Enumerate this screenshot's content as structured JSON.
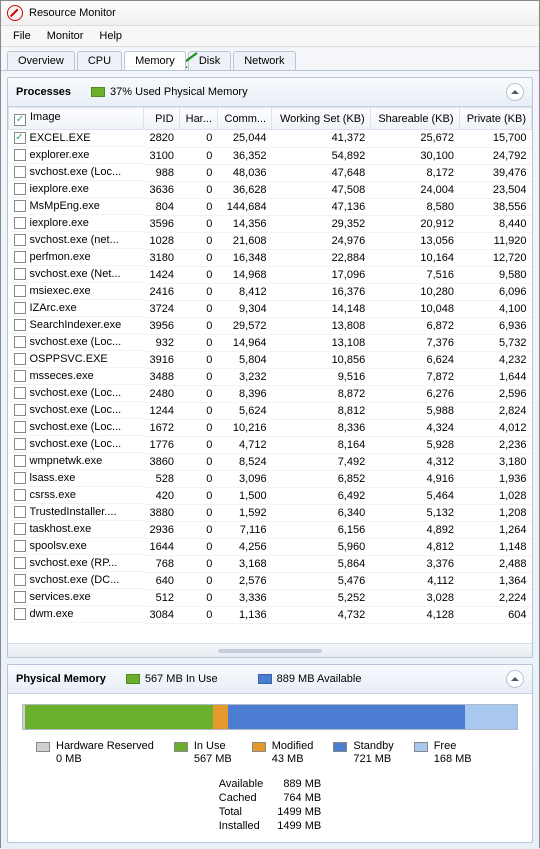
{
  "window": {
    "title": "Resource Monitor"
  },
  "menu": {
    "file": "File",
    "monitor": "Monitor",
    "help": "Help"
  },
  "tabs": {
    "overview": "Overview",
    "cpu": "CPU",
    "memory": "Memory",
    "disk": "Disk",
    "network": "Network"
  },
  "processes": {
    "title": "Processes",
    "usage_label": "37% Used Physical Memory",
    "columns": {
      "image": "Image",
      "pid": "PID",
      "hard": "Har...",
      "commit": "Comm...",
      "working": "Working Set (KB)",
      "shareable": "Shareable (KB)",
      "private": "Private (KB)"
    },
    "rows": [
      {
        "chk": true,
        "image": "EXCEL.EXE",
        "pid": "2820",
        "hard": "0",
        "commit": "25,044",
        "working": "41,372",
        "shareable": "25,672",
        "private": "15,700"
      },
      {
        "chk": false,
        "image": "explorer.exe",
        "pid": "3100",
        "hard": "0",
        "commit": "36,352",
        "working": "54,892",
        "shareable": "30,100",
        "private": "24,792"
      },
      {
        "chk": false,
        "image": "svchost.exe (Loc...",
        "pid": "988",
        "hard": "0",
        "commit": "48,036",
        "working": "47,648",
        "shareable": "8,172",
        "private": "39,476"
      },
      {
        "chk": false,
        "image": "iexplore.exe",
        "pid": "3636",
        "hard": "0",
        "commit": "36,628",
        "working": "47,508",
        "shareable": "24,004",
        "private": "23,504"
      },
      {
        "chk": false,
        "image": "MsMpEng.exe",
        "pid": "804",
        "hard": "0",
        "commit": "144,684",
        "working": "47,136",
        "shareable": "8,580",
        "private": "38,556"
      },
      {
        "chk": false,
        "image": "iexplore.exe",
        "pid": "3596",
        "hard": "0",
        "commit": "14,356",
        "working": "29,352",
        "shareable": "20,912",
        "private": "8,440"
      },
      {
        "chk": false,
        "image": "svchost.exe (net...",
        "pid": "1028",
        "hard": "0",
        "commit": "21,608",
        "working": "24,976",
        "shareable": "13,056",
        "private": "11,920"
      },
      {
        "chk": false,
        "image": "perfmon.exe",
        "pid": "3180",
        "hard": "0",
        "commit": "16,348",
        "working": "22,884",
        "shareable": "10,164",
        "private": "12,720"
      },
      {
        "chk": false,
        "image": "svchost.exe (Net...",
        "pid": "1424",
        "hard": "0",
        "commit": "14,968",
        "working": "17,096",
        "shareable": "7,516",
        "private": "9,580"
      },
      {
        "chk": false,
        "image": "msiexec.exe",
        "pid": "2416",
        "hard": "0",
        "commit": "8,412",
        "working": "16,376",
        "shareable": "10,280",
        "private": "6,096"
      },
      {
        "chk": false,
        "image": "IZArc.exe",
        "pid": "3724",
        "hard": "0",
        "commit": "9,304",
        "working": "14,148",
        "shareable": "10,048",
        "private": "4,100"
      },
      {
        "chk": false,
        "image": "SearchIndexer.exe",
        "pid": "3956",
        "hard": "0",
        "commit": "29,572",
        "working": "13,808",
        "shareable": "6,872",
        "private": "6,936"
      },
      {
        "chk": false,
        "image": "svchost.exe (Loc...",
        "pid": "932",
        "hard": "0",
        "commit": "14,964",
        "working": "13,108",
        "shareable": "7,376",
        "private": "5,732"
      },
      {
        "chk": false,
        "image": "OSPPSVC.EXE",
        "pid": "3916",
        "hard": "0",
        "commit": "5,804",
        "working": "10,856",
        "shareable": "6,624",
        "private": "4,232"
      },
      {
        "chk": false,
        "image": "msseces.exe",
        "pid": "3488",
        "hard": "0",
        "commit": "3,232",
        "working": "9,516",
        "shareable": "7,872",
        "private": "1,644"
      },
      {
        "chk": false,
        "image": "svchost.exe (Loc...",
        "pid": "2480",
        "hard": "0",
        "commit": "8,396",
        "working": "8,872",
        "shareable": "6,276",
        "private": "2,596"
      },
      {
        "chk": false,
        "image": "svchost.exe (Loc...",
        "pid": "1244",
        "hard": "0",
        "commit": "5,624",
        "working": "8,812",
        "shareable": "5,988",
        "private": "2,824"
      },
      {
        "chk": false,
        "image": "svchost.exe (Loc...",
        "pid": "1672",
        "hard": "0",
        "commit": "10,216",
        "working": "8,336",
        "shareable": "4,324",
        "private": "4,012"
      },
      {
        "chk": false,
        "image": "svchost.exe (Loc...",
        "pid": "1776",
        "hard": "0",
        "commit": "4,712",
        "working": "8,164",
        "shareable": "5,928",
        "private": "2,236"
      },
      {
        "chk": false,
        "image": "wmpnetwk.exe",
        "pid": "3860",
        "hard": "0",
        "commit": "8,524",
        "working": "7,492",
        "shareable": "4,312",
        "private": "3,180"
      },
      {
        "chk": false,
        "image": "lsass.exe",
        "pid": "528",
        "hard": "0",
        "commit": "3,096",
        "working": "6,852",
        "shareable": "4,916",
        "private": "1,936"
      },
      {
        "chk": false,
        "image": "csrss.exe",
        "pid": "420",
        "hard": "0",
        "commit": "1,500",
        "working": "6,492",
        "shareable": "5,464",
        "private": "1,028"
      },
      {
        "chk": false,
        "image": "TrustedInstaller....",
        "pid": "3880",
        "hard": "0",
        "commit": "1,592",
        "working": "6,340",
        "shareable": "5,132",
        "private": "1,208"
      },
      {
        "chk": false,
        "image": "taskhost.exe",
        "pid": "2936",
        "hard": "0",
        "commit": "7,116",
        "working": "6,156",
        "shareable": "4,892",
        "private": "1,264"
      },
      {
        "chk": false,
        "image": "spoolsv.exe",
        "pid": "1644",
        "hard": "0",
        "commit": "4,256",
        "working": "5,960",
        "shareable": "4,812",
        "private": "1,148"
      },
      {
        "chk": false,
        "image": "svchost.exe (RP...",
        "pid": "768",
        "hard": "0",
        "commit": "3,168",
        "working": "5,864",
        "shareable": "3,376",
        "private": "2,488"
      },
      {
        "chk": false,
        "image": "svchost.exe (DC...",
        "pid": "640",
        "hard": "0",
        "commit": "2,576",
        "working": "5,476",
        "shareable": "4,112",
        "private": "1,364"
      },
      {
        "chk": false,
        "image": "services.exe",
        "pid": "512",
        "hard": "0",
        "commit": "3,336",
        "working": "5,252",
        "shareable": "3,028",
        "private": "2,224"
      },
      {
        "chk": false,
        "image": "dwm.exe",
        "pid": "3084",
        "hard": "0",
        "commit": "1,136",
        "working": "4,732",
        "shareable": "4,128",
        "private": "604"
      }
    ]
  },
  "physical": {
    "title": "Physical Memory",
    "in_use_label": "567 MB In Use",
    "available_label": "889 MB Available",
    "segments": [
      {
        "name": "hardware",
        "color": "#d0d0d0",
        "pct": 0.5
      },
      {
        "name": "inuse",
        "color": "#6ab02c",
        "pct": 38
      },
      {
        "name": "modified",
        "color": "#e69a2c",
        "pct": 3
      },
      {
        "name": "standby",
        "color": "#4a7dd1",
        "pct": 48
      },
      {
        "name": "free",
        "color": "#a9c8ef",
        "pct": 10.5
      }
    ],
    "legend": {
      "hardware": {
        "label": "Hardware Reserved",
        "value": "0 MB",
        "color": "#d0d0d0"
      },
      "inuse": {
        "label": "In Use",
        "value": "567 MB",
        "color": "#6ab02c"
      },
      "modified": {
        "label": "Modified",
        "value": "43 MB",
        "color": "#e69a2c"
      },
      "standby": {
        "label": "Standby",
        "value": "721 MB",
        "color": "#4a7dd1"
      },
      "free": {
        "label": "Free",
        "value": "168 MB",
        "color": "#a9c8ef"
      }
    },
    "stats": {
      "available": {
        "label": "Available",
        "value": "889 MB"
      },
      "cached": {
        "label": "Cached",
        "value": "764 MB"
      },
      "total": {
        "label": "Total",
        "value": "1499 MB"
      },
      "installed": {
        "label": "Installed",
        "value": "1499 MB"
      }
    }
  }
}
